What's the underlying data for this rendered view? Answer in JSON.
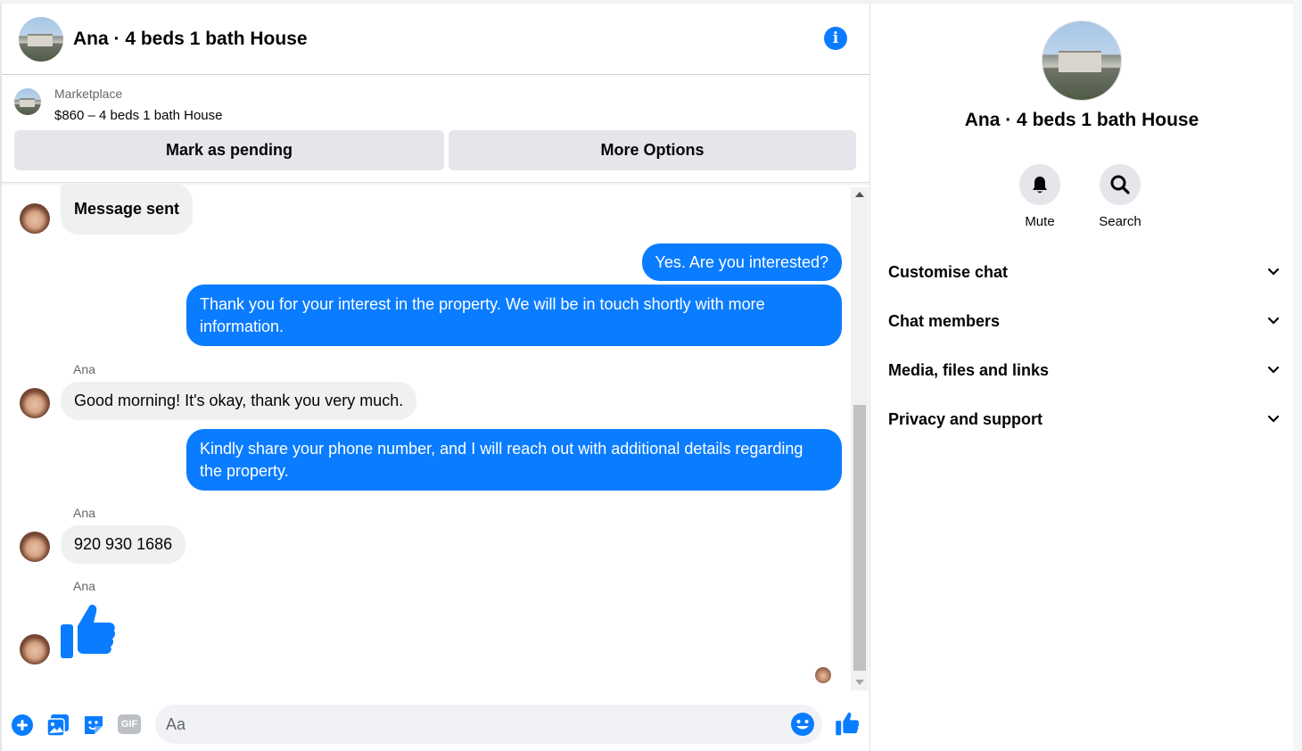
{
  "header": {
    "title": "Ana · 4 beds 1 bath House",
    "info_icon": "info-icon"
  },
  "listing": {
    "source_label": "Marketplace",
    "price_title": "$860 – 4 beds 1 bath House",
    "mark_pending_label": "Mark as pending",
    "more_options_label": "More Options"
  },
  "messages": {
    "msg1_text": "Message sent",
    "msg2_text": "Yes. Are you interested?",
    "msg3_text": "Thank you for your interest in the property. We will be in touch shortly with more information.",
    "sender1": "Ana",
    "msg4_text": "Good morning! It's okay, thank you very much.",
    "msg5_text": "Kindly share your phone number, and I will reach out with additional details regarding the property.",
    "sender2": "Ana",
    "msg6_text": "920 930 1686",
    "sender3": "Ana",
    "msg7_icon": "thumbs-up-icon"
  },
  "composer": {
    "placeholder": "Aa",
    "gif_label": "GIF"
  },
  "info_panel": {
    "title": "Ana · 4 beds 1 bath House",
    "mute_label": "Mute",
    "search_label": "Search",
    "sections": {
      "customise": "Customise chat",
      "members": "Chat members",
      "media": "Media, files and links",
      "privacy": "Privacy and support"
    }
  },
  "colors": {
    "accent": "#0a7cff",
    "bubble_in": "#f0f0f0",
    "button_gray": "#e4e6eb"
  }
}
